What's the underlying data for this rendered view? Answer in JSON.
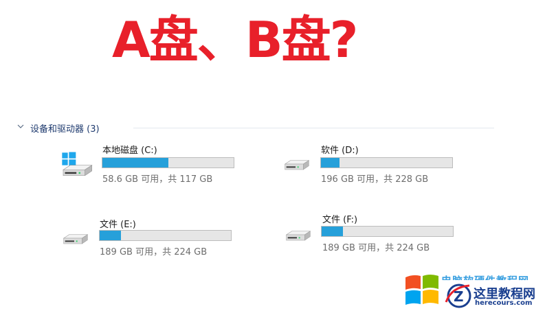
{
  "headline": "A盘、B盘?",
  "group": {
    "title": "设备和驱动器 (3)"
  },
  "drives": [
    {
      "name": "本地磁盘 (C:)",
      "space": "58.6 GB 可用，共 117 GB",
      "used_fraction": 0.5,
      "icon": "windows-system-drive-icon"
    },
    {
      "name": "软件 (D:)",
      "space": "196 GB 可用，共 228 GB",
      "used_fraction": 0.14,
      "icon": "hard-drive-icon"
    },
    {
      "name": "文件 (E:)",
      "space": "189 GB 可用，共 224 GB",
      "used_fraction": 0.16,
      "icon": "hard-drive-icon"
    },
    {
      "name": "文件 (F:)",
      "space": "189 GB 可用，共 224 GB",
      "used_fraction": 0.16,
      "icon": "hard-drive-icon"
    }
  ],
  "watermark": {
    "blue_text": "电脑软硬件教程网",
    "cn": "这里教程网",
    "en": "herecours.com"
  },
  "colors": {
    "headline": "#e8202a",
    "bar_fill": "#26a0da",
    "group_title": "#1e3a6e"
  }
}
